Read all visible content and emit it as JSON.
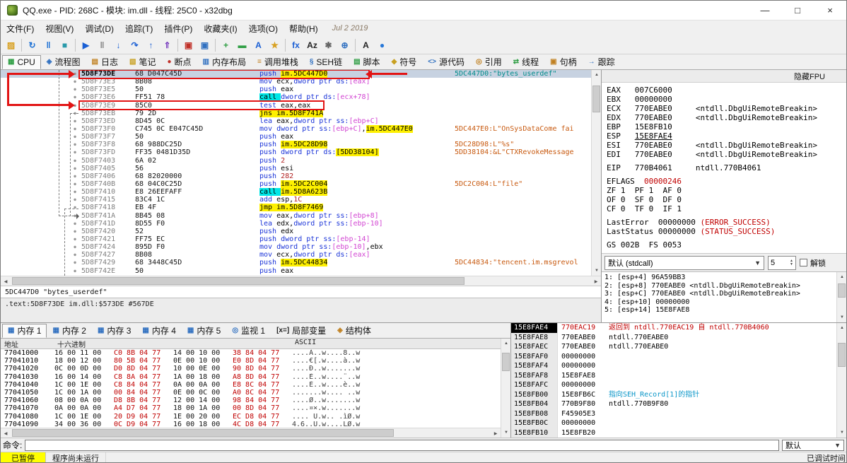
{
  "window": {
    "title": "QQ.exe - PID: 268C - 模块: im.dll - 线程: 25C0 - x32dbg",
    "controls": {
      "minimize": "—",
      "maximize": "□",
      "close": "×"
    }
  },
  "menu": {
    "items": [
      "文件(F)",
      "视图(V)",
      "调试(D)",
      "追踪(T)",
      "插件(P)",
      "收藏夹(I)",
      "选项(O)",
      "帮助(H)"
    ],
    "date": "Jul 2 2019"
  },
  "ui": {
    "up": "▲",
    "down": "▼",
    "left": "◀",
    "right": "▶"
  },
  "toolbar": {
    "icons": [
      {
        "name": "open-file-icon",
        "glyph": "▨",
        "color": "#d8a020"
      },
      {
        "sep": true
      },
      {
        "name": "restart-icon",
        "glyph": "↻",
        "color": "#1a6fd4"
      },
      {
        "name": "pause-icon",
        "glyph": "‖",
        "color": "#1a6fd4"
      },
      {
        "name": "stop-icon",
        "glyph": "■",
        "color": "#2a9aaa"
      },
      {
        "sep": true
      },
      {
        "name": "run-icon",
        "glyph": "▶",
        "color": "#1a5fd4"
      },
      {
        "name": "pause2-icon",
        "glyph": "‖",
        "color": "#808080"
      },
      {
        "name": "step-into-icon",
        "glyph": "↓",
        "color": "#1a5fd4"
      },
      {
        "name": "step-over-icon",
        "glyph": "↷",
        "color": "#1a5fd4"
      },
      {
        "name": "step-out-icon",
        "glyph": "↑",
        "color": "#1a5fd4"
      },
      {
        "name": "execute-till-return-icon",
        "glyph": "⇑",
        "color": "#7a3fbf"
      },
      {
        "sep": true
      },
      {
        "name": "trace-into-icon",
        "glyph": "▣",
        "color": "#c03028"
      },
      {
        "name": "trace-over-icon",
        "glyph": "▣",
        "color": "#3070c0"
      },
      {
        "sep": true
      },
      {
        "name": "patches-icon",
        "glyph": "+",
        "color": "#2f9e44"
      },
      {
        "name": "comment-icon",
        "glyph": "▬",
        "color": "#2f9e44"
      },
      {
        "name": "label-icon",
        "glyph": "A",
        "color": "#1a5fd4"
      },
      {
        "name": "bookmark-icon",
        "glyph": "★",
        "color": "#d8a020"
      },
      {
        "sep": true
      },
      {
        "name": "function-icon",
        "glyph": "fx",
        "color": "#1a5fd4"
      },
      {
        "name": "strings-icon",
        "glyph": "Az",
        "color": "#222222"
      },
      {
        "name": "preferences-icon",
        "glyph": "✱",
        "color": "#666666"
      },
      {
        "name": "settings-icon",
        "glyph": "⊕",
        "color": "#3070c0"
      },
      {
        "sep": true
      },
      {
        "name": "topmost-icon",
        "glyph": "A",
        "color": "#222222"
      },
      {
        "name": "help-icon",
        "glyph": "●",
        "color": "#2878d8"
      }
    ]
  },
  "tabs": {
    "items": [
      {
        "name": "tab-cpu",
        "label": "CPU",
        "icon": "▦",
        "color": "#2f9e44",
        "active": true
      },
      {
        "name": "tab-graph",
        "label": "流程图",
        "icon": "◈",
        "color": "#3070c0"
      },
      {
        "name": "tab-log",
        "label": "日志",
        "icon": "▤",
        "color": "#c08020"
      },
      {
        "name": "tab-notes",
        "label": "笔记",
        "icon": "▧",
        "color": "#c8a020"
      },
      {
        "name": "tab-breakpoints",
        "label": "断点",
        "icon": "●",
        "color": "#c03028"
      },
      {
        "name": "tab-memory-map",
        "label": "内存布局",
        "icon": "▥",
        "color": "#3070c0"
      },
      {
        "name": "tab-call-stack",
        "label": "调用堆栈",
        "icon": "≡",
        "color": "#c08020"
      },
      {
        "name": "tab-seh",
        "label": "SEH链",
        "icon": "§",
        "color": "#3070c0"
      },
      {
        "name": "tab-script",
        "label": "脚本",
        "icon": "▤",
        "color": "#2f9e44"
      },
      {
        "name": "tab-symbols",
        "label": "符号",
        "icon": "◆",
        "color": "#c8a020"
      },
      {
        "name": "tab-source",
        "label": "源代码",
        "icon": "<>",
        "color": "#3070c0"
      },
      {
        "name": "tab-references",
        "label": "引用",
        "icon": "◎",
        "color": "#c08020"
      },
      {
        "name": "tab-threads",
        "label": "线程",
        "icon": "⇄",
        "color": "#2f9e44"
      },
      {
        "name": "tab-handles",
        "label": "句柄",
        "icon": "▣",
        "color": "#c08020"
      },
      {
        "name": "tab-trace",
        "label": "跟踪",
        "icon": "→",
        "color": "#3070c0"
      }
    ]
  },
  "disasm": {
    "dot": "●",
    "info1": "5DC447D0 \"bytes_userdef\"",
    "info2": ".text:5D8F73DE im.dll:$573DE #567DE",
    "rows": [
      {
        "a": "5D8F73DE",
        "b": "68 D047C45D",
        "i": [
          [
            "push ",
            "m"
          ],
          [
            "im.5DC447D0",
            "mod"
          ]
        ],
        "c": "5DC447D0:\"bytes_userdef\"",
        "cc": "teal",
        "sel": true
      },
      {
        "a": "5D8F73E3",
        "b": "8B08",
        "i": [
          [
            "mov ",
            "m"
          ],
          [
            "ecx",
            ""
          ],
          [
            ",",
            ""
          ],
          [
            "dword ptr ds:",
            "m"
          ],
          [
            "[eax]",
            "mem"
          ]
        ]
      },
      {
        "a": "5D8F73E5",
        "b": "50",
        "i": [
          [
            "push ",
            "m"
          ],
          [
            "eax",
            ""
          ]
        ]
      },
      {
        "a": "5D8F73E6",
        "b": "FF51 78",
        "i": [
          [
            "call ",
            "callm"
          ],
          [
            "dword ptr ds:",
            "m"
          ],
          [
            "[ecx+78]",
            "mem"
          ]
        ]
      },
      {
        "a": "5D8F73E9",
        "b": "85C0",
        "i": [
          [
            "test ",
            "m"
          ],
          [
            "eax",
            ""
          ],
          [
            ",",
            ""
          ],
          [
            "eax",
            ""
          ]
        ]
      },
      {
        "a": "5D8F73EB",
        "b": "79 2D",
        "i": [
          [
            "jns ",
            "jm"
          ],
          [
            "im.5D8F741A",
            "jm"
          ]
        ]
      },
      {
        "a": "5D8F73ED",
        "b": "8D45 0C",
        "i": [
          [
            "lea ",
            "m"
          ],
          [
            "eax",
            ""
          ],
          [
            ",",
            ""
          ],
          [
            "dword ptr ss:",
            "m"
          ],
          [
            "[ebp+C]",
            "mem"
          ]
        ]
      },
      {
        "a": "5D8F73F0",
        "b": "C745 0C E047C45D",
        "i": [
          [
            "mov ",
            "m"
          ],
          [
            "dword ptr ss:",
            "m"
          ],
          [
            "[ebp+C]",
            "mem"
          ],
          [
            ",",
            ""
          ],
          [
            "im.5DC447E0",
            "mod"
          ]
        ],
        "c": "5DC447E0:L\"OnSysDataCome fai",
        "cc": "orange"
      },
      {
        "a": "5D8F73F7",
        "b": "50",
        "i": [
          [
            "push ",
            "m"
          ],
          [
            "eax",
            ""
          ]
        ]
      },
      {
        "a": "5D8F73F8",
        "b": "68 988DC25D",
        "i": [
          [
            "push ",
            "m"
          ],
          [
            "im.5DC28D98",
            "mod"
          ]
        ],
        "c": "5DC28D98:L\"%s\"",
        "cc": "orange"
      },
      {
        "a": "5D8F73FD",
        "b": "FF35 0481D35D",
        "i": [
          [
            "push ",
            "m"
          ],
          [
            "dword ptr ds:",
            "m"
          ],
          [
            "[5DD38104]",
            "mod"
          ]
        ],
        "c": "5DD38104:&L\"CTXRevokeMessage",
        "cc": "orange"
      },
      {
        "a": "5D8F7403",
        "b": "6A 02",
        "i": [
          [
            "push ",
            "m"
          ],
          [
            "2",
            "i"
          ]
        ]
      },
      {
        "a": "5D8F7405",
        "b": "56",
        "i": [
          [
            "push ",
            "m"
          ],
          [
            "esi",
            ""
          ]
        ]
      },
      {
        "a": "5D8F7406",
        "b": "68 82020000",
        "i": [
          [
            "push ",
            "m"
          ],
          [
            "282",
            "i"
          ]
        ]
      },
      {
        "a": "5D8F740B",
        "b": "68 04C0C25D",
        "i": [
          [
            "push ",
            "m"
          ],
          [
            "im.5DC2C004",
            "mod"
          ]
        ],
        "c": "5DC2C004:L\"file\"",
        "cc": "orange"
      },
      {
        "a": "5D8F7410",
        "b": "E8 26EEFAFF",
        "i": [
          [
            "call ",
            "callm"
          ],
          [
            "im.5D8A623B",
            "mod"
          ]
        ]
      },
      {
        "a": "5D8F7415",
        "b": "83C4 1C",
        "i": [
          [
            "add ",
            "m"
          ],
          [
            "esp",
            ""
          ],
          [
            ",",
            ""
          ],
          [
            "1C",
            "i"
          ]
        ]
      },
      {
        "a": "5D8F7418",
        "b": "EB 4F",
        "i": [
          [
            "jmp ",
            "jm"
          ],
          [
            "im.5D8F7469",
            "jm"
          ]
        ]
      },
      {
        "a": "5D8F741A",
        "b": "8B45 08",
        "i": [
          [
            "mov ",
            "m"
          ],
          [
            "eax",
            ""
          ],
          [
            ",",
            ""
          ],
          [
            "dword ptr ss:",
            "m"
          ],
          [
            "[ebp+8]",
            "mem"
          ]
        ]
      },
      {
        "a": "5D8F741D",
        "b": "8D55 F0",
        "i": [
          [
            "lea ",
            "m"
          ],
          [
            "edx",
            ""
          ],
          [
            ",",
            ""
          ],
          [
            "dword ptr ss:",
            "m"
          ],
          [
            "[ebp-10]",
            "mem"
          ]
        ]
      },
      {
        "a": "5D8F7420",
        "b": "52",
        "i": [
          [
            "push ",
            "m"
          ],
          [
            "edx",
            ""
          ]
        ]
      },
      {
        "a": "5D8F7421",
        "b": "FF75 EC",
        "i": [
          [
            "push ",
            "m"
          ],
          [
            "dword ptr ss:",
            "m"
          ],
          [
            "[ebp-14]",
            "mem"
          ]
        ]
      },
      {
        "a": "5D8F7424",
        "b": "895D F0",
        "i": [
          [
            "mov ",
            "m"
          ],
          [
            "dword ptr ss:",
            "m"
          ],
          [
            "[ebp-10]",
            "mem"
          ],
          [
            ",",
            ""
          ],
          [
            "ebx",
            ""
          ]
        ]
      },
      {
        "a": "5D8F7427",
        "b": "8B08",
        "i": [
          [
            "mov ",
            "m"
          ],
          [
            "ecx",
            ""
          ],
          [
            ",",
            ""
          ],
          [
            "dword ptr ds:",
            "m"
          ],
          [
            "[eax]",
            "mem"
          ]
        ]
      },
      {
        "a": "5D8F7429",
        "b": "68 3448C45D",
        "i": [
          [
            "push ",
            "m"
          ],
          [
            "im.5DC44834",
            "mod"
          ]
        ],
        "c": "5DC44834:\"tencent.im.msgrevol",
        "cc": "orange"
      },
      {
        "a": "5D8F742E",
        "b": "50",
        "i": [
          [
            "push ",
            "m"
          ],
          [
            "eax",
            ""
          ]
        ]
      }
    ]
  },
  "registers": {
    "fpu_label": "隐藏FPU",
    "calling_convention": "默认 (stdcall)",
    "arg_count": "5",
    "unlock_label": "解锁",
    "rows": [
      [
        [
          "EAX   007C6000",
          ""
        ]
      ],
      [
        [
          "EBX   00000000",
          ""
        ]
      ],
      [
        [
          "ECX   770EABE0     <ntdll.DbgUiRemoteBreakin>",
          ""
        ]
      ],
      [
        [
          "EDX   770EABE0     <ntdll.DbgUiRemoteBreakin>",
          ""
        ]
      ],
      [
        [
          "EBP   15E8FB10",
          ""
        ]
      ],
      [
        [
          "ESP   ",
          ""
        ],
        [
          "15E8FAE4",
          "ul"
        ]
      ],
      [
        [
          "ESI   770EABE0     <ntdll.DbgUiRemoteBreakin>",
          ""
        ]
      ],
      [
        [
          "EDI   770EABE0     <ntdll.DbgUiRemoteBreakin>",
          ""
        ]
      ],
      [],
      [
        [
          "EIP   770B4061     ntdll.770B4061",
          ""
        ]
      ],
      [],
      [
        [
          "EFLAGS  ",
          ""
        ],
        [
          "00000246",
          "red"
        ]
      ],
      [
        [
          "ZF 1  PF 1  AF 0",
          ""
        ]
      ],
      [
        [
          "OF 0  SF 0  DF 0",
          ""
        ]
      ],
      [
        [
          "CF 0  TF 0  IF 1",
          ""
        ]
      ],
      [],
      [
        [
          "LastError  00000000 ",
          ""
        ],
        [
          "(ERROR_SUCCESS)",
          "red"
        ]
      ],
      [
        [
          "LastStatus 00000000 ",
          ""
        ],
        [
          "(STATUS_SUCCESS)",
          "red"
        ]
      ],
      [],
      [
        [
          "GS 002B  FS 0053",
          ""
        ]
      ]
    ]
  },
  "args": {
    "lines": [
      "1: [esp+4] 96A59BB3",
      "2: [esp+8] 770EABE0 <ntdll.DbgUiRemoteBreakin>",
      "3: [esp+C] 770EABE0 <ntdll.DbgUiRemoteBreakin>",
      "4: [esp+10] 00000000",
      "5: [esp+14] 15E8FAE8"
    ]
  },
  "memory": {
    "headers": {
      "addr": "地址",
      "hex": "十六进制",
      "ascii": "ASCII"
    },
    "tabs": [
      {
        "name": "tab-memory-1",
        "label": "内存 1",
        "icon": "▦",
        "color": "#3070c0",
        "active": true
      },
      {
        "name": "tab-memory-2",
        "label": "内存 2",
        "icon": "▦",
        "color": "#3070c0"
      },
      {
        "name": "tab-memory-3",
        "label": "内存 3",
        "icon": "▦",
        "color": "#3070c0"
      },
      {
        "name": "tab-memory-4",
        "label": "内存 4",
        "icon": "▦",
        "color": "#3070c0"
      },
      {
        "name": "tab-memory-5",
        "label": "内存 5",
        "icon": "▦",
        "color": "#3070c0"
      },
      {
        "name": "tab-watch-1",
        "label": "监视 1",
        "icon": "◎",
        "color": "#3070c0"
      },
      {
        "name": "tab-locals",
        "label": "局部变量",
        "icon": "[x=]",
        "color": "#222222"
      },
      {
        "name": "tab-struct",
        "label": "结构体",
        "icon": "◈",
        "color": "#c08020"
      }
    ],
    "rows": [
      {
        "a": "77041000",
        "g": [
          "16 00 11 00",
          "C0 8B 04 77",
          "14 00 10 00",
          "38 84 04 77"
        ],
        "t": "....À..w....8..w"
      },
      {
        "a": "77041010",
        "g": [
          "18 00 12 00",
          "80 5B 04 77",
          "0E 00 10 00",
          "E0 8D 04 77"
        ],
        "t": "....€[.w....à..w"
      },
      {
        "a": "77041020",
        "g": [
          "0C 00 0D 00",
          "D0 8D 04 77",
          "10 00 0E 00",
          "90 8D 04 77"
        ],
        "t": "....Ð..w.......w"
      },
      {
        "a": "77041030",
        "g": [
          "16 00 14 00",
          "C8 8A 04 77",
          "1A 00 18 00",
          "A8 8D 04 77"
        ],
        "t": "....È..w....¨..w"
      },
      {
        "a": "77041040",
        "g": [
          "1C 00 1E 00",
          "C8 84 04 77",
          "0A 00 0A 00",
          "E8 8C 04 77"
        ],
        "t": "....È..w....è..w"
      },
      {
        "a": "77041050",
        "g": [
          "1C 00 1A 00",
          "00 84 04 77",
          "0E 00 0C 00",
          "A0 8C 04 77"
        ],
        "t": ".......w.... ..w"
      },
      {
        "a": "77041060",
        "g": [
          "08 00 0A 00",
          "D8 8B 04 77",
          "12 00 14 00",
          "98 84 04 77"
        ],
        "t": "....Ø..w.......w"
      },
      {
        "a": "77041070",
        "g": [
          "0A 00 0A 00",
          "A4 D7 04 77",
          "18 00 1A 00",
          "00 8D 04 77"
        ],
        "t": "....¤×.w.......w"
      },
      {
        "a": "77041080",
        "g": [
          "1C 00 1E 00",
          "20 D9 04 77",
          "1E 00 20 00",
          "EC D8 04 77"
        ],
        "t": ".... Ù.w.. .ìØ.w"
      },
      {
        "a": "77041090",
        "g": [
          "34 00 36 00",
          "0C D9 04 77",
          "16 00 18 00",
          "4C D8 04 77"
        ],
        "t": "4.6..Ù.w....LØ.w"
      }
    ]
  },
  "stack": {
    "rows": [
      {
        "a": "15E8FAE4",
        "v": "770EAC19",
        "vc": "red",
        "c": "返回到 ntdll.770EAC19 自 ntdll.770B4060",
        "cc": "red",
        "sel": true
      },
      {
        "a": "15E8FAE8",
        "v": "770EABE0",
        "c": "ntdll.770EABE0"
      },
      {
        "a": "15E8FAEC",
        "v": "770EABE0",
        "c": "ntdll.770EABE0"
      },
      {
        "a": "15E8FAF0",
        "v": "00000000"
      },
      {
        "a": "15E8FAF4",
        "v": "00000000"
      },
      {
        "a": "15E8FAF8",
        "v": "15E8FAE8"
      },
      {
        "a": "15E8FAFC",
        "v": "00000000"
      },
      {
        "a": "15E8FB00",
        "v": "15E8FB6C",
        "c": "指向SEH_Record[1]的指针",
        "cc": "cyan"
      },
      {
        "a": "15E8FB04",
        "v": "770B9F80",
        "c": "ntdll.770B9F80"
      },
      {
        "a": "15E8FB08",
        "v": "F45905E3"
      },
      {
        "a": "15E8FB0C",
        "v": "00000000"
      },
      {
        "a": "15E8FB10",
        "v": "15E8FB20"
      }
    ]
  },
  "command": {
    "label": "命令:",
    "combo": "默认"
  },
  "status": {
    "state": "已暂停",
    "message": "程序尚未运行",
    "right": "已调试时间"
  }
}
